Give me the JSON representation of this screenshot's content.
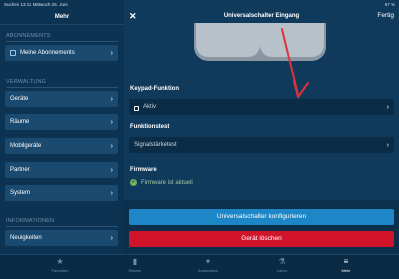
{
  "statusbar": {
    "left": "Suchen  13:11  Mittwoch 25. Juni",
    "right": "67 %"
  },
  "sidebar": {
    "title": "Mehr",
    "sections": {
      "abonnements": "ABONNEMENTS",
      "verwaltung": "VERWALTUNG",
      "informationen": "INFORMATIONEN"
    },
    "items": {
      "abos": "Meine Abonnements",
      "geraete": "Geräte",
      "raeume": "Räume",
      "mobilgeraete": "Mobilgeräte",
      "partner": "Partner",
      "system": "System",
      "neuigkeiten": "Neuigkeiten"
    }
  },
  "header": {
    "close": "✕",
    "title": "Universalschalter Eingang",
    "done": "Fertig"
  },
  "keypad": {
    "label": "Keypad-Funktion",
    "value": "Aktiv"
  },
  "funktionstest": {
    "label": "Funktionstest",
    "value": "Signalstärketest"
  },
  "firmware": {
    "label": "Firmware",
    "status": "Firmware ist aktuell"
  },
  "buttons": {
    "configure": "Universalschalter konfigurieren",
    "delete": "Gerät löschen"
  },
  "tabs": [
    "Favoriten",
    "Räume",
    "Automation",
    "Labor",
    "Mehr"
  ],
  "colors": {
    "accent": "#1c86c7",
    "danger": "#d2142a",
    "background": "#0f3a5c"
  }
}
